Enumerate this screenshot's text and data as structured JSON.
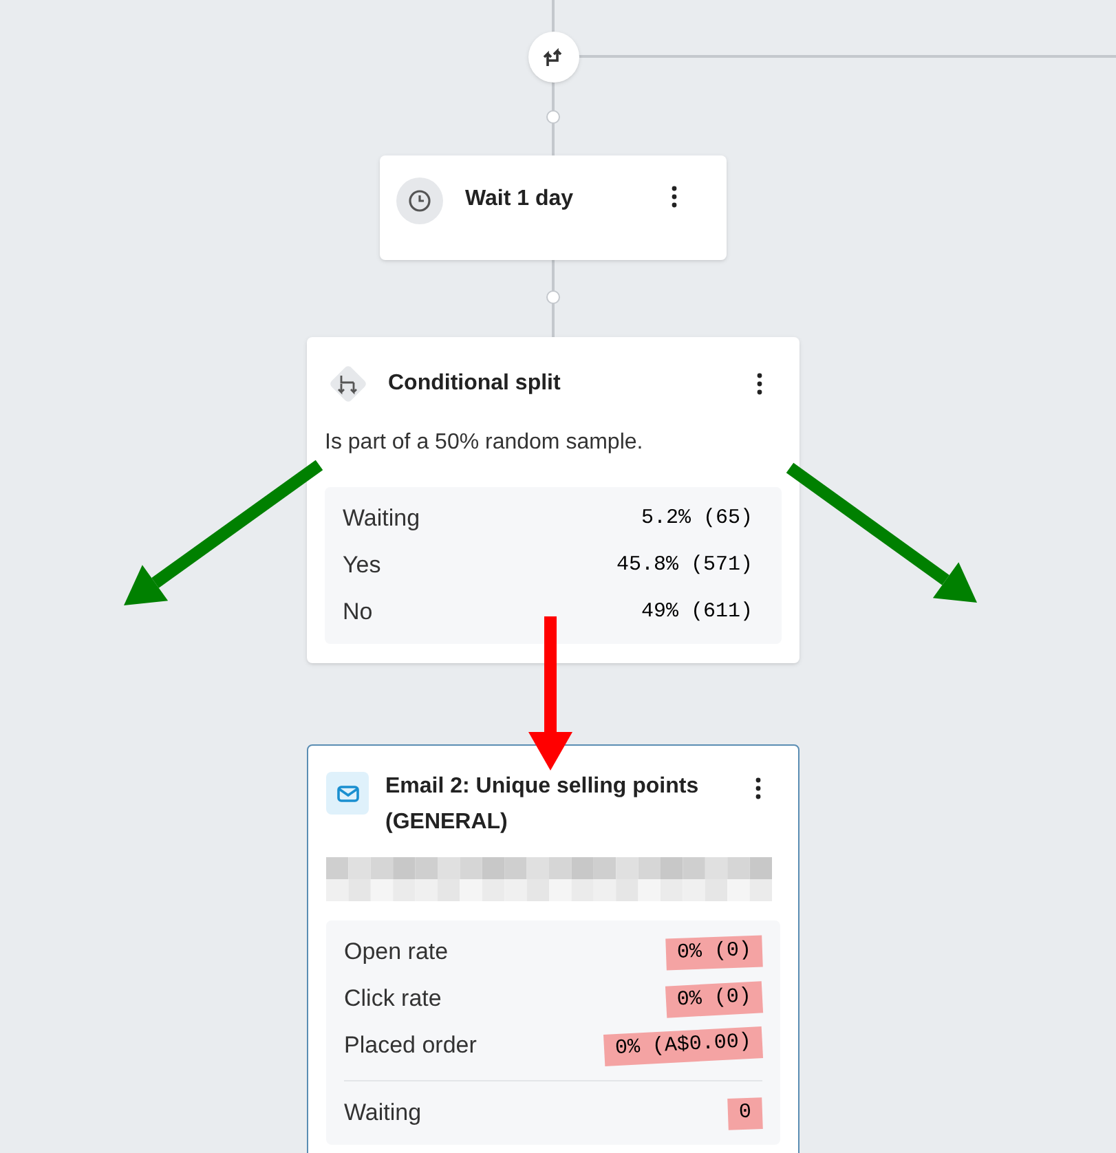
{
  "wait_node": {
    "title": "Wait 1 day"
  },
  "split_node": {
    "title": "Conditional split",
    "description": "Is part of a 50% random sample.",
    "stats": [
      {
        "label": "Waiting",
        "value": "5.2% (65)"
      },
      {
        "label": "Yes",
        "value": "45.8% (571)"
      },
      {
        "label": "No",
        "value": "49% (611)"
      }
    ]
  },
  "email_node": {
    "title": "Email 2: Unique selling points (GENERAL)",
    "stats": [
      {
        "label": "Open rate",
        "value": "0% (0)",
        "highlighted": true
      },
      {
        "label": "Click rate",
        "value": "0% (0)",
        "highlighted": true
      },
      {
        "label": "Placed order",
        "value": "0% (A$0.00)",
        "highlighted": true
      }
    ],
    "waiting": {
      "label": "Waiting",
      "value": "0",
      "highlighted": true
    }
  },
  "annotations": [
    {
      "kind": "arrow",
      "color": "#008000"
    },
    {
      "kind": "arrow",
      "color": "#008000"
    },
    {
      "kind": "arrow",
      "color": "#ff0000"
    }
  ]
}
